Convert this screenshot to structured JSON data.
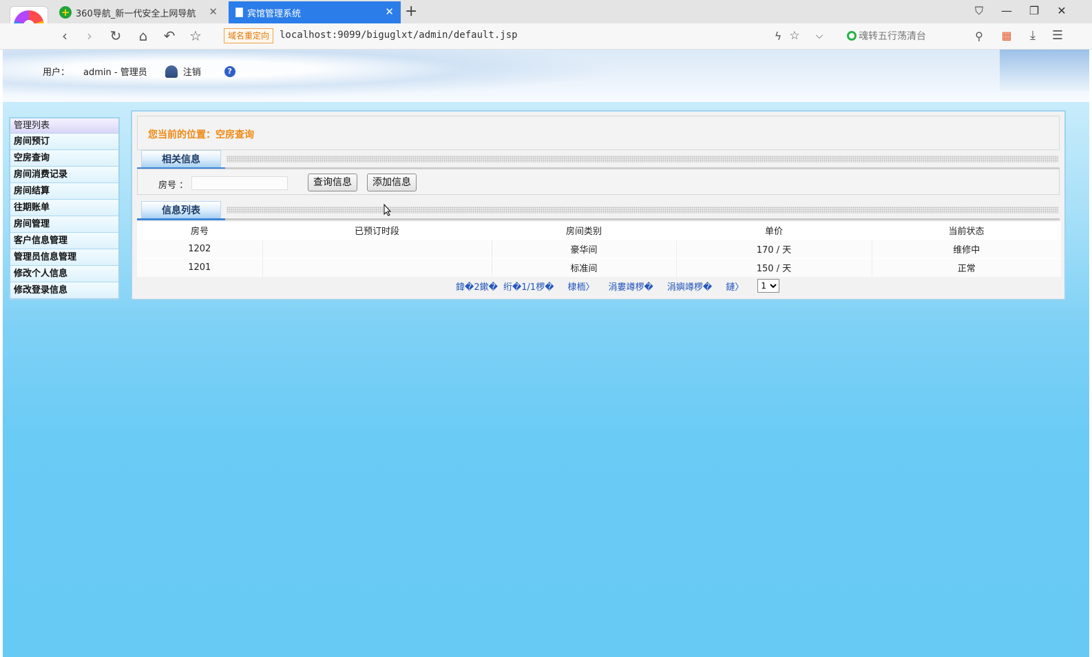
{
  "browser": {
    "tabs": [
      {
        "title": "360导航_新一代安全上网导航",
        "active": false
      },
      {
        "title": "宾馆管理系统",
        "active": true
      }
    ],
    "redirect_badge": "域名重定向",
    "url": "localhost:9099/biguglxt/admin/default.jsp",
    "search_text": "魂转五行荡清台",
    "accent_color": "#2b7de9"
  },
  "header": {
    "user_label": "用户：",
    "user_value": "admin - 管理员",
    "logout": "注销",
    "help_glyph": "?"
  },
  "sidebar": {
    "title": "管理列表",
    "items": [
      {
        "label": "房间预订"
      },
      {
        "label": "空房查询"
      },
      {
        "label": "房间消费记录"
      },
      {
        "label": "房间结算"
      },
      {
        "label": "往期账单"
      },
      {
        "label": "房间管理"
      },
      {
        "label": "客户信息管理"
      },
      {
        "label": "管理员信息管理"
      },
      {
        "label": "修改个人信息"
      },
      {
        "label": "修改登录信息"
      }
    ]
  },
  "main": {
    "breadcrumb": "您当前的位置：空房查询",
    "section_related": "相关信息",
    "search": {
      "room_label": "房号 ：",
      "room_value": "",
      "query_button": "查询信息",
      "add_button": "添加信息"
    },
    "section_list": "信息列表",
    "table": {
      "columns": [
        "房号",
        "已预订时段",
        "房间类别",
        "单价",
        "当前状态"
      ],
      "rows": [
        [
          "1202",
          "",
          "豪华间",
          "170 / 天",
          "维修中"
        ],
        [
          "1201",
          "",
          "标准间",
          "150 / 天",
          "正常"
        ]
      ]
    },
    "pager": {
      "total": "鍏�2鏉�",
      "page_info": "绗�1/1椤�",
      "first": "棣栭〉",
      "prev": "涓婁竴椤�",
      "next": "涓嬩竴椤�",
      "last": "鏈〉",
      "page_select": "1"
    },
    "colors": {
      "breadcrumb": "#ef8a14",
      "pager_link": "#2255bb"
    }
  }
}
